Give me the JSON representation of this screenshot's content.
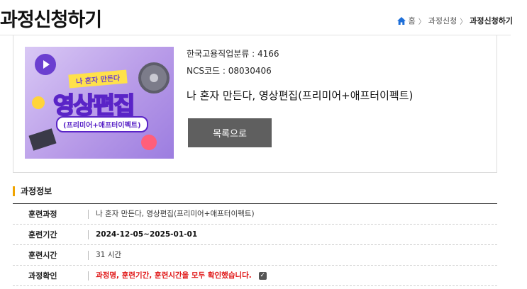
{
  "header": {
    "title": "과정신청하기",
    "breadcrumb": {
      "home": "홈",
      "separator": "〉",
      "level1": "과정신청",
      "current": "과정신청하기"
    }
  },
  "course": {
    "thumbnail": {
      "tag": "나 혼자 만든다",
      "title": "영상편집",
      "subtitle": "(프리미어+애프터이펙트)"
    },
    "classification": "한국고용직업분류 : 4166",
    "ncs_code": "NCS코드 : 08030406",
    "name": "나 혼자 만든다, 영상편집(프리미어+애프터이펙트)",
    "list_button": "목록으로"
  },
  "section": {
    "title": "과정정보"
  },
  "info_rows": [
    {
      "label": "훈련과정",
      "value": "나 혼자 만든다, 영상편집(프리미어+애프터이펙트)"
    },
    {
      "label": "훈련기간",
      "value": "2024-12-05~2025-01-01"
    },
    {
      "label": "훈련시간",
      "value": "31 시간"
    },
    {
      "label": "과정확인",
      "value": "과정명, 훈련기간, 훈련시간을 모두 확인했습니다.",
      "checked": true
    }
  ],
  "colors": {
    "accent_bar": "#f0a400",
    "warning_text": "#e01616",
    "breadcrumb_home_icon": "#1e6fd9",
    "button_bg": "#5f5f5f"
  }
}
